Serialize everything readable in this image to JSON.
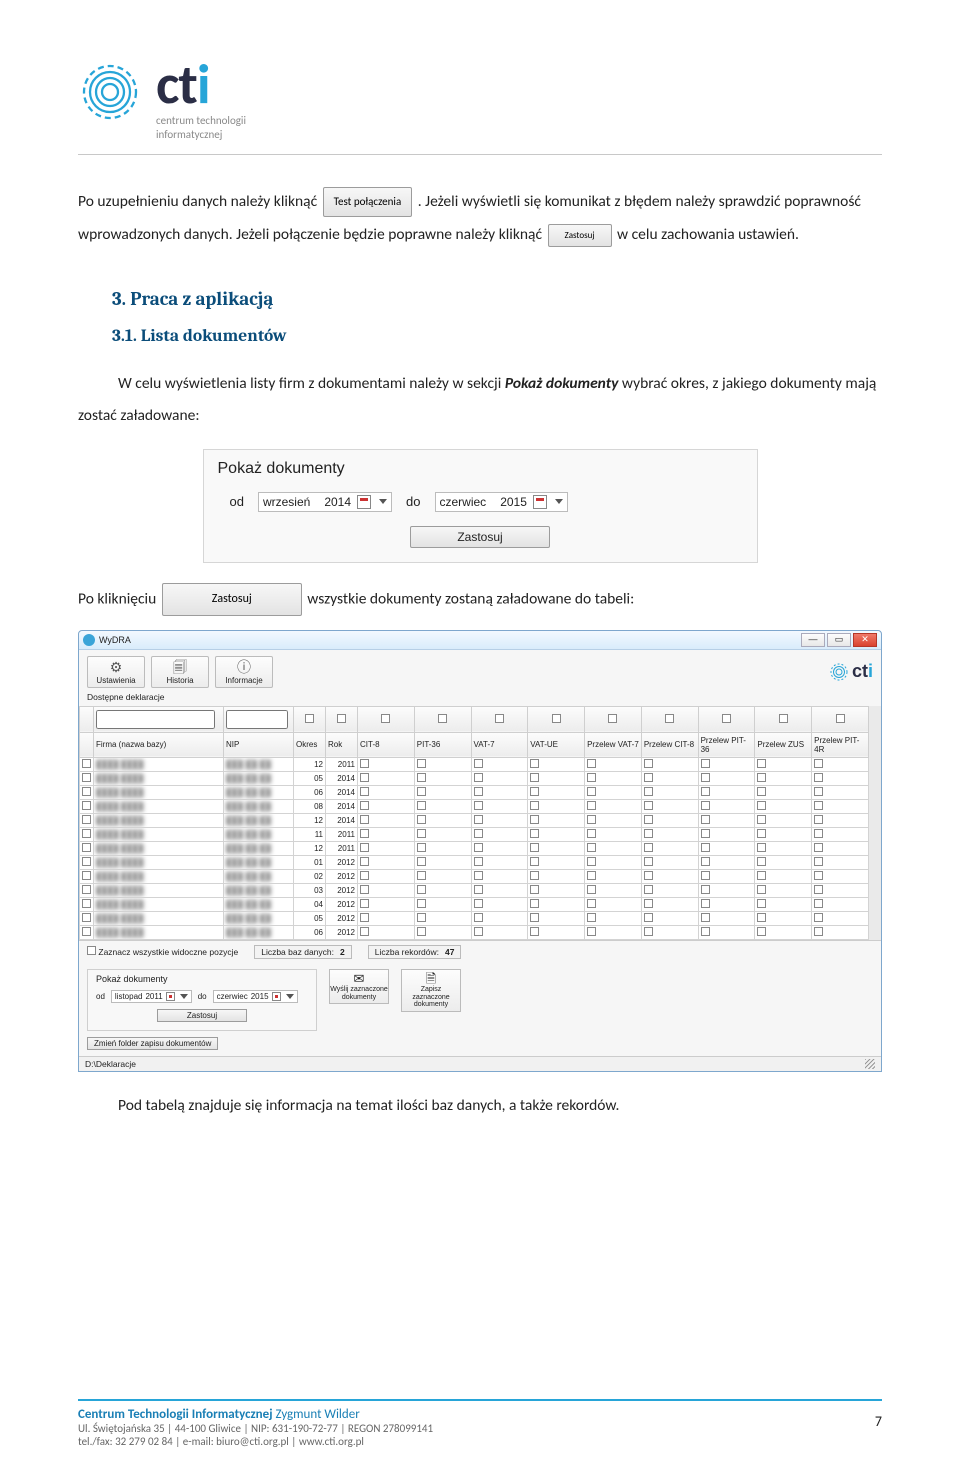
{
  "header": {
    "brand": "cti",
    "tagline1": "centrum technologii",
    "tagline2": "informatycznej"
  },
  "body": {
    "p1a": "Po uzupełnieniu danych należy kliknąć ",
    "btn_test": "Test połączenia",
    "p1b": ". Jeżeli wyświetli się komunikat z błędem należy sprawdzić poprawność wprowadzonych danych. Jeżeli połączenie będzie poprawne należy kliknąć ",
    "btn_zastosuj_small": "Zastosuj",
    "p1c": " w celu zachowania ustawień.",
    "h2": "3.   Praca z aplikacją",
    "h3": "3.1.   Lista dokumentów",
    "para": "W celu wyświetlenia listy firm z dokumentami należy w sekcji ",
    "para_b": "Pokaż dokumenty",
    "para2": " wybrać okres, z jakiego dokumenty mają zostać załadowane:",
    "after_filter_a": "Po kliknięciu ",
    "after_filter_b": " wszystkie dokumenty zostaną załadowane do tabeli:",
    "after_table": "Pod tabelą znajduje się informacja na temat ilości baz danych, a także rekordów."
  },
  "filter": {
    "title": "Pokaż dokumenty",
    "od": "od",
    "do": "do",
    "from_m": "wrzesień",
    "from_y": "2014",
    "to_m": "czerwiec",
    "to_y": "2015",
    "apply": "Zastosuj"
  },
  "app": {
    "title": "WyDRA",
    "toolbar": {
      "ustawienia": "Ustawienia",
      "historia": "Historia",
      "informacje": "Informacje"
    },
    "section": "Dostępne deklaracje",
    "columns": [
      "",
      "Firma (nazwa bazy)",
      "NIP",
      "Okres",
      "Rok",
      "CIT-8",
      "PIT-36",
      "VAT-7",
      "VAT-UE",
      "Przelew VAT-7",
      "Przelew CIT-8",
      "Przelew PIT-36",
      "Przelew ZUS",
      "Przelew PIT-4R"
    ],
    "rows": [
      {
        "okres": "12",
        "rok": "2011",
        "c": [
          "r",
          "r",
          "r",
          "o",
          "o",
          "r",
          "r",
          "r",
          "r"
        ]
      },
      {
        "okres": "05",
        "rok": "2014",
        "c": [
          "r",
          "r",
          "r",
          "r",
          "r",
          "r",
          "r",
          "r",
          "r"
        ]
      },
      {
        "okres": "06",
        "rok": "2014",
        "c": [
          "r",
          "g",
          "r",
          "r",
          "r",
          "r",
          "r",
          "r",
          "r"
        ]
      },
      {
        "okres": "08",
        "rok": "2014",
        "c": [
          "r",
          "r",
          "r",
          "r",
          "r",
          "g",
          "r",
          "r",
          "r"
        ]
      },
      {
        "okres": "12",
        "rok": "2014",
        "c": [
          "g",
          "r",
          "r",
          "r",
          "r",
          "r",
          "r",
          "r",
          "r"
        ]
      },
      {
        "okres": "11",
        "rok": "2011",
        "c": [
          "r",
          "r",
          "g",
          "r",
          "g",
          "g",
          "g",
          "g",
          "g"
        ]
      },
      {
        "okres": "12",
        "rok": "2011",
        "c": [
          "r",
          "r",
          "g",
          "g",
          "g",
          "g",
          "g",
          "g",
          "g"
        ]
      },
      {
        "okres": "01",
        "rok": "2012",
        "c": [
          "r",
          "r",
          "g",
          "r",
          "g",
          "g",
          "g",
          "g",
          "g"
        ]
      },
      {
        "okres": "02",
        "rok": "2012",
        "c": [
          "r",
          "r",
          "r",
          "r",
          "g",
          "g",
          "g",
          "g",
          "g"
        ]
      },
      {
        "okres": "03",
        "rok": "2012",
        "c": [
          "r",
          "r",
          "r",
          "r",
          "g",
          "g",
          "g",
          "g",
          "g"
        ]
      },
      {
        "okres": "04",
        "rok": "2012",
        "c": [
          "r",
          "r",
          "g",
          "r",
          "g",
          "g",
          "g",
          "g",
          "g"
        ]
      },
      {
        "okres": "05",
        "rok": "2012",
        "c": [
          "r",
          "r",
          "r",
          "r",
          "g",
          "g",
          "g",
          "g",
          "g"
        ]
      },
      {
        "okres": "06",
        "rok": "2012",
        "c": [
          "r",
          "r",
          "r",
          "r",
          "g",
          "g",
          "g",
          "g",
          "g"
        ]
      }
    ],
    "zaznacz": "Zaznacz wszystkie widoczne pozycje",
    "stat1_l": "Liczba baz danych:",
    "stat1_v": "2",
    "stat2_l": "Liczba rekordów:",
    "stat2_v": "47",
    "pd_title": "Pokaż dokumenty",
    "pd_od": "od",
    "pd_do": "do",
    "pd_from_m": "listopad",
    "pd_from_y": "2011",
    "pd_to_m": "czerwiec",
    "pd_to_y": "2015",
    "pd_apply": "Zastosuj",
    "change_folder": "Zmień folder zapisu dokumentów",
    "act1": "Wyślij zaznaczone dokumenty",
    "act2": "Zapisz zaznaczone dokumenty",
    "status": "D:\\Deklaracje"
  },
  "footer": {
    "l1a": "Centrum Technologii Informatycznej",
    "l1b": " Zygmunt Wilder",
    "l2": "Ul. Świętojańska 35 | 44-100 Gliwice | NIP: 631-190-72-77 | REGON 278099141",
    "l3": "tel./fax: 32 279 02 84 | e-mail: biuro@cti.org.pl | www.cti.org.pl",
    "page": "7"
  }
}
